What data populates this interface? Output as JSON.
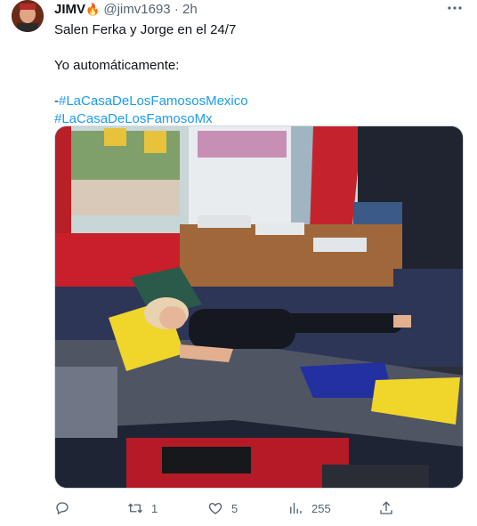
{
  "tweet": {
    "display_name": "JIMV",
    "name_emoji": "🔥",
    "handle": "@jimv1693",
    "separator": "·",
    "time": "2h",
    "more_icon": "more-dots-icon",
    "text_line1": "Salen Ferka y Jorge en el 24/7",
    "text_line2": "Yo automáticamente:",
    "hashtag_prefix": "-",
    "hashtag1": "#LaCasaDeLosFamososMexico",
    "hashtag2": "#LaCasaDeLosFamosoMx",
    "colors": {
      "link": "#1d9bf0",
      "muted": "#536471",
      "text": "#0f1419"
    }
  },
  "actions": {
    "reply": {
      "icon": "reply-icon",
      "count": ""
    },
    "retweet": {
      "icon": "retweet-icon",
      "count": "1"
    },
    "like": {
      "icon": "heart-icon",
      "count": "5"
    },
    "views": {
      "icon": "views-icon",
      "count": "255"
    },
    "share": {
      "icon": "share-icon",
      "count": ""
    }
  }
}
